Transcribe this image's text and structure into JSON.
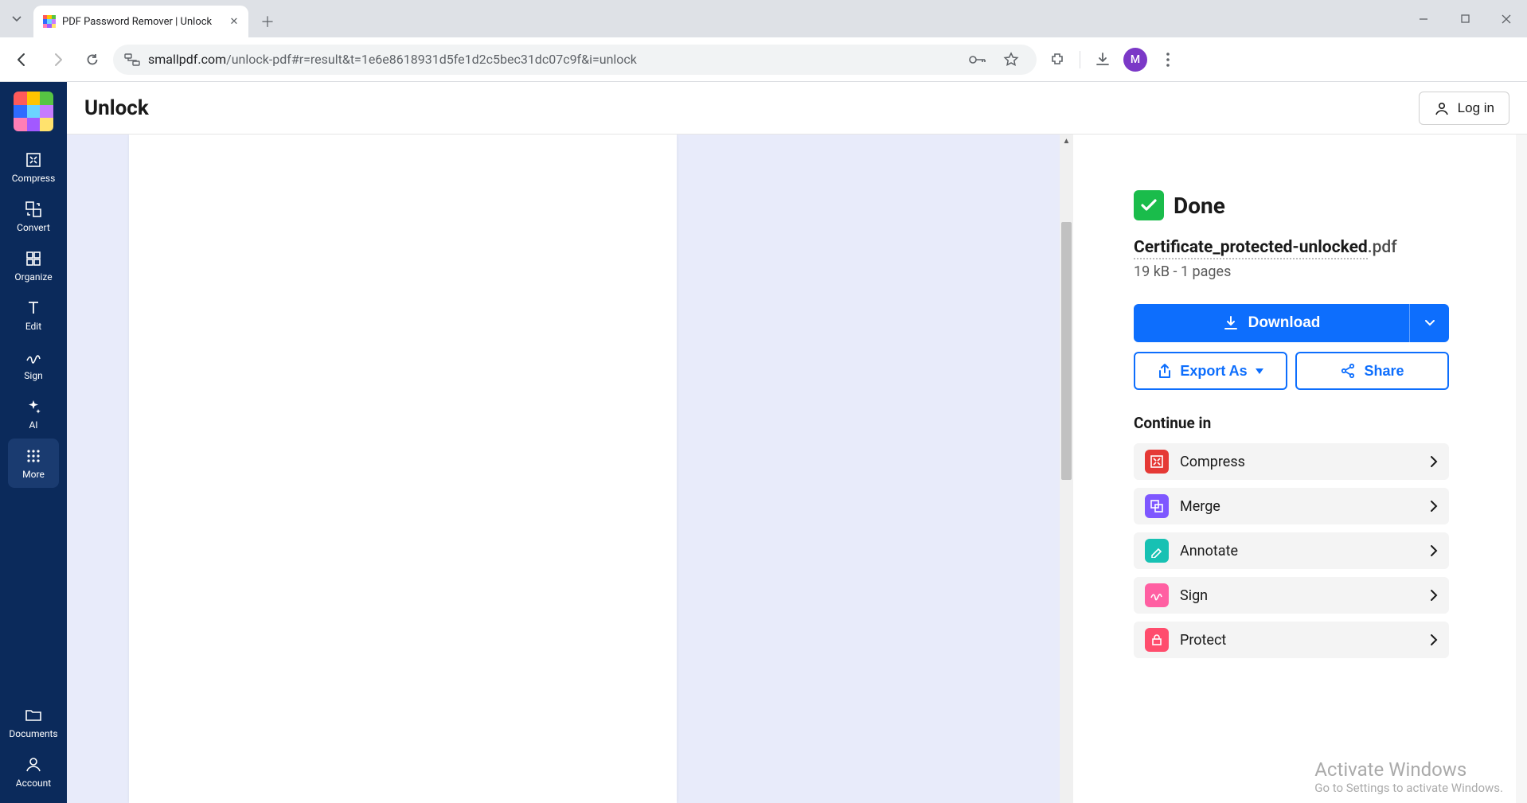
{
  "browser": {
    "tab_title": "PDF Password Remover | Unlock",
    "url_domain": "smallpdf.com",
    "url_path": "/unlock-pdf#r=result&t=1e6e8618931d5fe1d2c5bec31dc07c9f&i=unlock",
    "avatar_initial": "M"
  },
  "sidebar": {
    "items": [
      {
        "label": "Compress"
      },
      {
        "label": "Convert"
      },
      {
        "label": "Organize"
      },
      {
        "label": "Edit"
      },
      {
        "label": "Sign"
      },
      {
        "label": "AI"
      },
      {
        "label": "More"
      }
    ],
    "documents_label": "Documents",
    "account_label": "Account"
  },
  "header": {
    "title": "Unlock",
    "login_label": "Log in"
  },
  "result": {
    "done_label": "Done",
    "filename_base": "Certificate_protected-unlocked",
    "filename_ext": ".pdf",
    "meta": "19 kB - 1 pages",
    "download_label": "Download",
    "export_label": "Export As",
    "share_label": "Share",
    "continue_heading": "Continue in",
    "continue_items": [
      {
        "label": "Compress",
        "color": "#e53935"
      },
      {
        "label": "Merge",
        "color": "#7e57ff"
      },
      {
        "label": "Annotate",
        "color": "#17c1b3"
      },
      {
        "label": "Sign",
        "color": "#ff5fa2"
      },
      {
        "label": "Protect",
        "color": "#ff4d6d"
      }
    ]
  },
  "watermark": {
    "line1": "Activate Windows",
    "line2": "Go to Settings to activate Windows."
  }
}
